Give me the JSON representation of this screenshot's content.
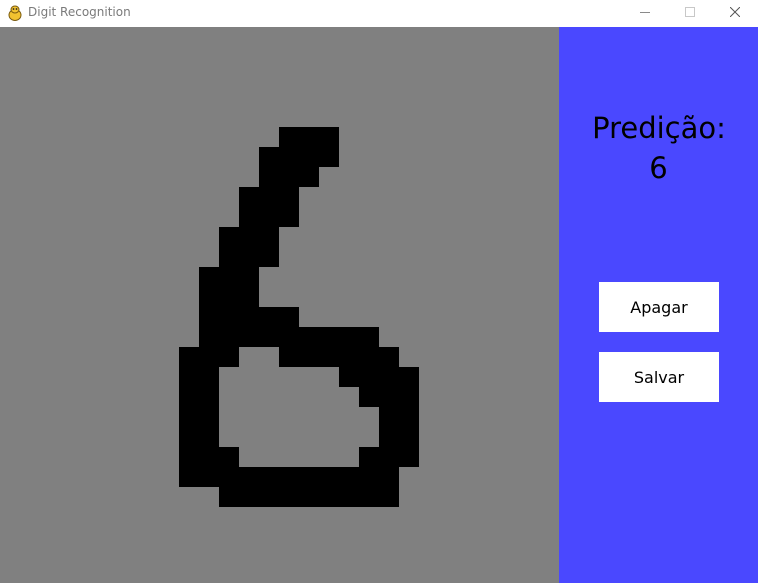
{
  "window": {
    "title": "Digit Recognition",
    "icon": "pygame-snake-icon",
    "controls": {
      "minimize": "—",
      "maximize": "☐",
      "close": "✕"
    }
  },
  "canvas": {
    "background": "#808080",
    "ink_color": "#000000",
    "grid_cell": 20,
    "drawn_digit": "6"
  },
  "panel": {
    "background": "#4a48ff",
    "prediction_label": "Predição:",
    "prediction_value": "6",
    "buttons": {
      "clear_label": "Apagar",
      "save_label": "Salvar"
    }
  }
}
